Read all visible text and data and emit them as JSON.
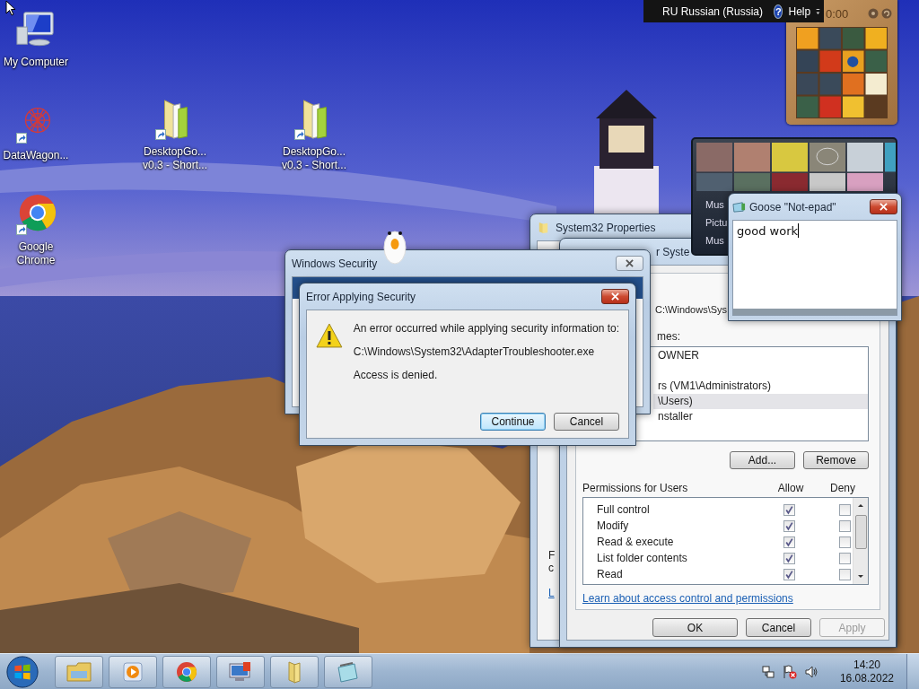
{
  "desktop_icons": [
    {
      "kind": "computer",
      "lines": [
        "My Computer"
      ],
      "shortcut": false
    },
    {
      "kind": "web",
      "lines": [
        "DataWagon..."
      ],
      "shortcut": true
    },
    {
      "kind": "folder",
      "lines": [
        "DesktopGo...",
        "v0.3 - Short..."
      ],
      "shortcut": true
    },
    {
      "kind": "folder",
      "lines": [
        "DesktopGo...",
        "v0.3 - Short..."
      ],
      "shortcut": true
    },
    {
      "kind": "chrome",
      "lines": [
        "Google",
        "Chrome"
      ],
      "shortcut": true
    }
  ],
  "language_bar": {
    "language": "RU Russian (Russia)",
    "help_icon": "?",
    "help": "Help"
  },
  "puzzle_gadget": {
    "timer": "0:00"
  },
  "media_gadget": {
    "items": [
      "Mus",
      "Pictu",
      "Mus"
    ]
  },
  "properties_window": {
    "title": "System32 Properties",
    "fragments": [
      {
        "text": "F",
        "kind": "text"
      },
      {
        "text": "c",
        "kind": "text"
      },
      {
        "text": "L",
        "kind": "link"
      }
    ]
  },
  "permissions_window": {
    "title": "r Syste",
    "object_name": "C:\\Windows\\Sys",
    "names_label": "mes:",
    "names": [
      {
        "label": "OWNER",
        "selected": false
      },
      {
        "label": "rs (VM1\\Administrators)",
        "selected": false
      },
      {
        "label": "\\Users)",
        "selected": true
      },
      {
        "label": "nstaller",
        "selected": false
      }
    ],
    "buttons": [
      "Add...",
      "Remove"
    ],
    "permissions_label": "Permissions for Users",
    "allow_header": "Allow",
    "deny_header": "Deny",
    "permissions": [
      {
        "name": "Full control",
        "allow": true,
        "deny": false
      },
      {
        "name": "Modify",
        "allow": true,
        "deny": false
      },
      {
        "name": "Read & execute",
        "allow": true,
        "deny": false
      },
      {
        "name": "List folder contents",
        "allow": true,
        "deny": false
      },
      {
        "name": "Read",
        "allow": true,
        "deny": false
      }
    ],
    "link": "Learn about access control and permissions",
    "footer_buttons": [
      {
        "label": "OK",
        "disabled": false
      },
      {
        "label": "Cancel",
        "disabled": false
      },
      {
        "label": "Apply",
        "disabled": true
      }
    ]
  },
  "security_window": {
    "title": "Windows Security"
  },
  "error_dialog": {
    "title": "Error Applying Security",
    "lines": [
      "An error occurred while applying security information to:",
      "C:\\Windows\\System32\\AdapterTroubleshooter.exe",
      "Access is denied."
    ],
    "buttons": [
      {
        "label": "Continue",
        "default": true
      },
      {
        "label": "Cancel",
        "default": false
      }
    ]
  },
  "notepad": {
    "title": "Goose \"Not-epad\"",
    "text": "good work"
  },
  "clock": {
    "time": "14:20",
    "date": "16.08.2022"
  }
}
